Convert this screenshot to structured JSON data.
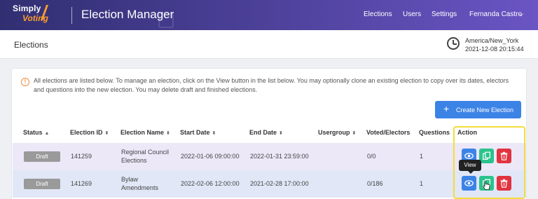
{
  "brand": {
    "line1": "Simply",
    "line2": "Voting"
  },
  "app_title": "Election Manager",
  "nav": {
    "elections": "Elections",
    "users": "Users",
    "settings": "Settings",
    "user": "Fernanda Castro",
    "chevron": "⌵"
  },
  "page_title": "Elections",
  "timezone": {
    "zone": "America/New_York",
    "datetime": "2021-12-08 20:15:44"
  },
  "info_text": "All elections are listed below. To manage an election, click on the View button in the list below. You may optionally clone an existing election to copy over its dates, electors and questions into the new election. You may delete draft and finished elections.",
  "new_election_label": "Create New Election",
  "columns": {
    "status": "Status",
    "id": "Election ID",
    "name": "Election Name",
    "start": "Start Date",
    "end": "End Date",
    "usergroup": "Usergroup",
    "voted": "Voted/Electors",
    "questions": "Questions",
    "action": "Action"
  },
  "rows": [
    {
      "status": "Draft",
      "id": "141259",
      "name_l1": "Regional Council",
      "name_l2": "Elections",
      "start": "2022-01-06 09:00:00",
      "end": "2022-01-31 23:59:00",
      "usergroup": "",
      "voted": "0/0",
      "questions": "1"
    },
    {
      "status": "Draft",
      "id": "141269",
      "name_l1": "Bylaw",
      "name_l2": "Amendments",
      "start": "2022-02-06 12:00:00",
      "end": "2021-02-28 17:00:00",
      "usergroup": "",
      "voted": "0/186",
      "questions": "1"
    }
  ],
  "tooltip": "View",
  "colors": {
    "primary": "#3c83e6",
    "clone": "#2bc38c",
    "delete": "#e23340",
    "accent": "#ff9c2a",
    "highlight": "#f3dd3a"
  },
  "icons": {
    "view": "eye-icon",
    "clone": "copy-icon",
    "delete": "trash-icon",
    "info": "info-icon",
    "clock": "clock-icon"
  }
}
